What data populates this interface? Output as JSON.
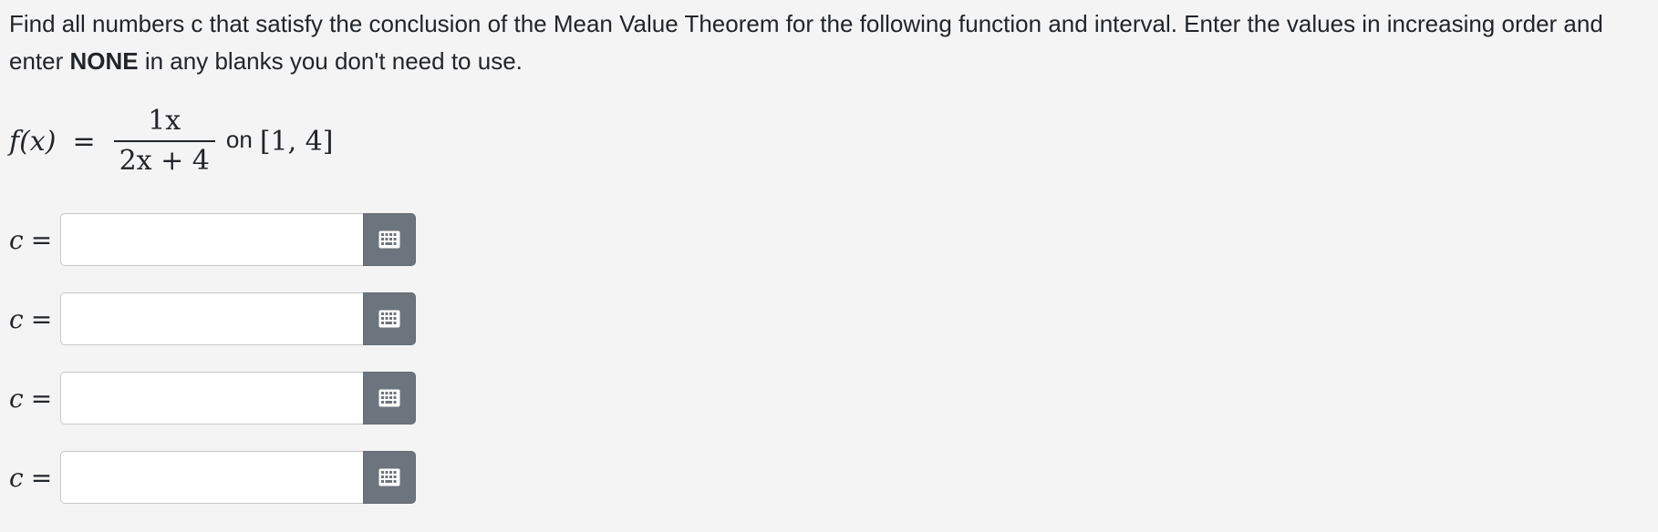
{
  "prompt": {
    "text_before": "Find all numbers c that satisfy the conclusion of the Mean Value Theorem for the following function and interval. Enter the values in increasing order and enter ",
    "bold_word": "NONE",
    "text_after": " in any blanks you don't need to use."
  },
  "formula": {
    "lhs": "f(x)",
    "equals": "=",
    "numerator": "1x",
    "denominator": "2x + 4",
    "on_word": "on",
    "interval": "[1, 4]"
  },
  "answers": [
    {
      "label_var": "c",
      "label_eq": "=",
      "value": "",
      "button_icon": "keyboard-icon"
    },
    {
      "label_var": "c",
      "label_eq": "=",
      "value": "",
      "button_icon": "keyboard-icon"
    },
    {
      "label_var": "c",
      "label_eq": "=",
      "value": "",
      "button_icon": "keyboard-icon"
    },
    {
      "label_var": "c",
      "label_eq": "=",
      "value": "",
      "button_icon": "keyboard-icon"
    }
  ],
  "colors": {
    "background": "#f4f4f4",
    "text": "#212529",
    "button": "#6c757d",
    "input_border": "#c8c8c8"
  }
}
